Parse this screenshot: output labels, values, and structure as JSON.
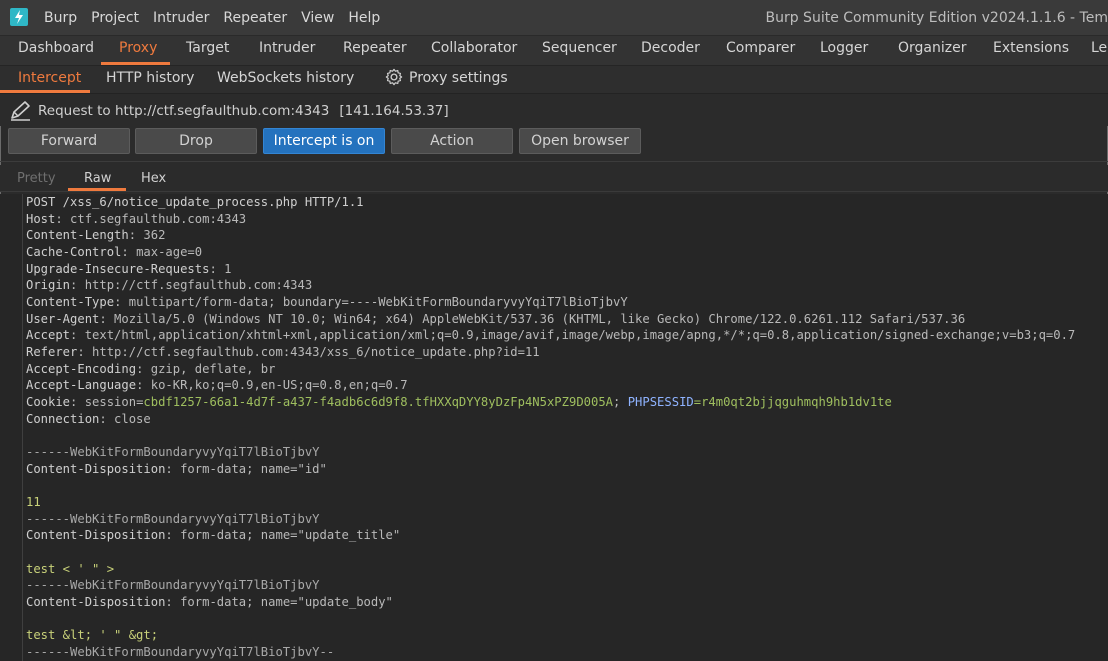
{
  "app": {
    "menu": [
      "Burp",
      "Project",
      "Intruder",
      "Repeater",
      "View",
      "Help"
    ],
    "window_title": "Burp Suite Community Edition v2024.1.1.6 - Tem"
  },
  "main_tabs": [
    "Dashboard",
    "Proxy",
    "Target",
    "Intruder",
    "Repeater",
    "Collaborator",
    "Sequencer",
    "Decoder",
    "Comparer",
    "Logger",
    "Organizer",
    "Extensions",
    "Le"
  ],
  "main_tab_active": "Proxy",
  "sub_tabs": {
    "intercept": "Intercept",
    "http_history": "HTTP history",
    "websockets_history": "WebSockets history",
    "proxy_settings": "Proxy settings"
  },
  "request": {
    "label": "Request to http://ctf.segfaulthub.com:4343",
    "ip": "[141.164.53.37]"
  },
  "buttons": {
    "forward": "Forward",
    "drop": "Drop",
    "intercept": "Intercept is on",
    "action": "Action",
    "open_browser": "Open browser"
  },
  "editor_tabs": {
    "pretty": "Pretty",
    "raw": "Raw",
    "hex": "Hex"
  },
  "code": {
    "l1": "POST /xss_6/notice_update_process.php HTTP/1.1",
    "l2k": "Host",
    "l2v": ": ctf.segfaulthub.com:4343",
    "l3k": "Content-Length",
    "l3v": ": 362",
    "l4k": "Cache-Control",
    "l4v": ": max-age=0",
    "l5k": "Upgrade-Insecure-Requests",
    "l5v": ": 1",
    "l6k": "Origin",
    "l6v": ": http://ctf.segfaulthub.com:4343",
    "l7k": "Content-Type",
    "l7v": ": multipart/form-data; boundary=----WebKitFormBoundaryvyYqiT7lBioTjbvY",
    "l8k": "User-Agent",
    "l8v": ": Mozilla/5.0 (Windows NT 10.0; Win64; x64) AppleWebKit/537.36 (KHTML, like Gecko) Chrome/122.0.6261.112 Safari/537.36",
    "l9k": "Accept",
    "l9v": ": text/html,application/xhtml+xml,application/xml;q=0.9,image/avif,image/webp,image/apng,*/*;q=0.8,application/signed-exchange;v=b3;q=0.7",
    "l10k": "Referer",
    "l10v": ": http://ctf.segfaulthub.com:4343/xss_6/notice_update.php?id=11",
    "l11k": "Accept-Encoding",
    "l11v": ": gzip, deflate, br",
    "l12k": "Accept-Language",
    "l12v": ": ko-KR,ko;q=0.9,en-US;q=0.8,en;q=0.7",
    "l13k": "Cookie",
    "l13a": ": session=",
    "l13b": "cbdf1257-66a1-4d7f-a437-f4adb6c6d9f8.tfHXXqDYY8yDzFp4N5xPZ9D005A",
    "l13c": "; ",
    "l13d": "PHPSESSID",
    "l13e": "=r4m0qt2bjjqguhmqh9hb1dv1te",
    "l14k": "Connection",
    "l14v": ": close",
    "l16": "------WebKitFormBoundaryvyYqiT7lBioTjbvY",
    "l17k": "Content-Disposition",
    "l17v": ": form-data; name=\"id\"",
    "l19": "11",
    "l20": "------WebKitFormBoundaryvyYqiT7lBioTjbvY",
    "l21k": "Content-Disposition",
    "l21v": ": form-data; name=\"update_title\"",
    "l23": "test < ' \" >",
    "l24": "------WebKitFormBoundaryvyYqiT7lBioTjbvY",
    "l25k": "Content-Disposition",
    "l25v": ": form-data; name=\"update_body\"",
    "l27": "test &lt; ' \" &gt;",
    "l28": "------WebKitFormBoundaryvyYqiT7lBioTjbvY--"
  },
  "colors": {
    "accent": "#ef7a3e",
    "intercept_on": "#2472be",
    "logo": "#2fb7c6"
  }
}
